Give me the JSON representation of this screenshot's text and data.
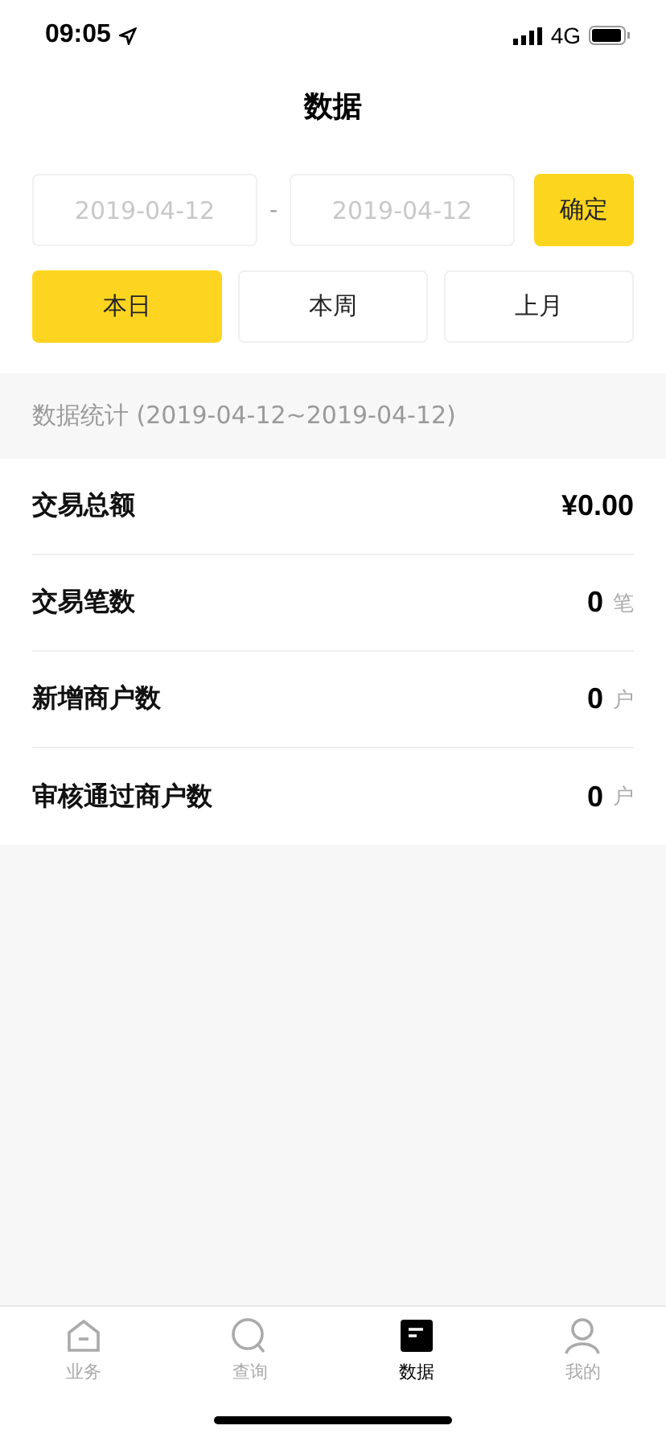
{
  "status_bar": {
    "time": "09:05",
    "network": "4G"
  },
  "title": "数据",
  "date_range": {
    "start": "2019-04-12",
    "separator": "-",
    "end": "2019-04-12",
    "confirm": "确定"
  },
  "periods": [
    {
      "label": "本日",
      "selected": true
    },
    {
      "label": "本周",
      "selected": false
    },
    {
      "label": "上月",
      "selected": false
    }
  ],
  "summary_header": "数据统计 (2019-04-12~2019-04-12)",
  "stats": [
    {
      "label": "交易总额",
      "value": "¥0.00"
    },
    {
      "label": "交易笔数",
      "value": "0",
      "unit": "笔"
    },
    {
      "label": "新增商户数",
      "value": "0",
      "unit": "户"
    },
    {
      "label": "审核通过商户数",
      "value": "0",
      "unit": "户"
    }
  ],
  "tab_bar": [
    {
      "kind": "home",
      "label": "业务",
      "selected": false
    },
    {
      "kind": "search",
      "label": "查询",
      "selected": false
    },
    {
      "kind": "data",
      "label": "数据",
      "selected": true
    },
    {
      "kind": "profile",
      "label": "我的",
      "selected": false
    }
  ]
}
